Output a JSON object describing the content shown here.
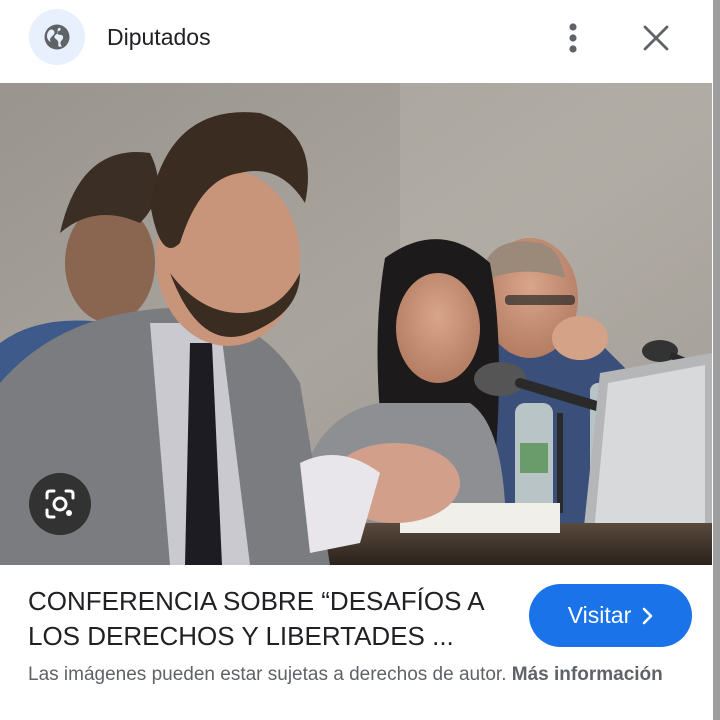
{
  "header": {
    "site_name": "Diputados",
    "icons": [
      "globe-icon",
      "more-vert-icon",
      "close-icon"
    ]
  },
  "image": {
    "description_icon": "google-lens-icon"
  },
  "result": {
    "title_line1": "CONFERENCIA SOBRE “DESAFÍOS A",
    "title_line2": "LOS DERECHOS Y LIBERTADES ...",
    "visit_label": "Visitar"
  },
  "notice": {
    "text": "Las imágenes pueden estar sujetas a derechos de autor.",
    "more_label": "Más información"
  },
  "colors": {
    "accent": "#1a73e8",
    "globe_bg": "#e8f0fe",
    "text_primary": "#202124",
    "text_secondary": "#5f6368"
  }
}
